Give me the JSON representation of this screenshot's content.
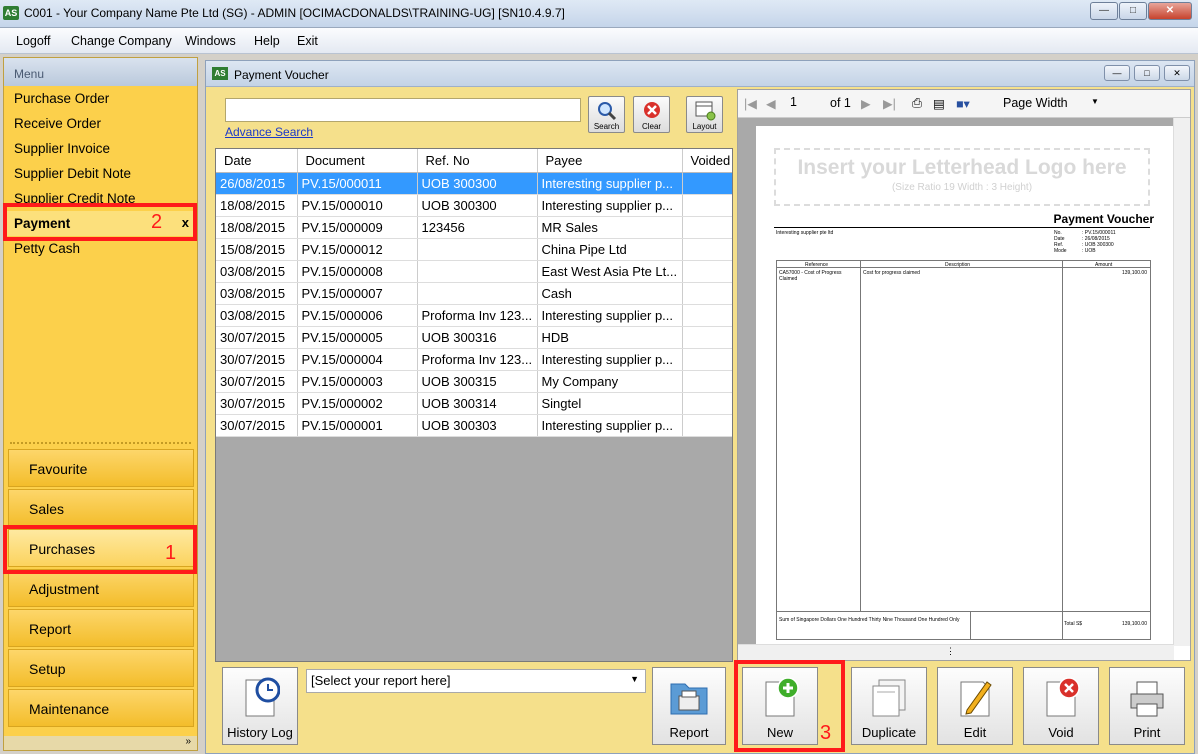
{
  "window": {
    "title": "C001 - Your Company Name Pte Ltd (SG) - ADMIN [OCIMACDONALDS\\TRAINING-UG] [SN10.4.9.7]",
    "app_icon": "AS"
  },
  "menubar": [
    "Logoff",
    "Change Company",
    "Windows",
    "Help",
    "Exit"
  ],
  "sidebar": {
    "header": "Menu",
    "items": [
      "Purchase Order",
      "Receive Order",
      "Supplier Invoice",
      "Supplier Debit Note",
      "Supplier Credit Note",
      "Payment",
      "Petty Cash"
    ],
    "active_item": "Payment",
    "close_label": "x",
    "groups": [
      "Favourite",
      "Sales",
      "Purchases",
      "Adjustment",
      "Report",
      "Setup",
      "Maintenance"
    ]
  },
  "annotations": [
    "1",
    "2",
    "3"
  ],
  "main": {
    "title": "Payment Voucher",
    "icon": "AS",
    "search_placeholder": "",
    "advance_search": "Advance Search",
    "tool_buttons": [
      "Search",
      "Clear",
      "Layout"
    ],
    "columns": [
      "Date",
      "Document",
      "Ref. No",
      "Payee",
      "Voided"
    ],
    "rows": [
      [
        "26/08/2015",
        "PV.15/000011",
        "UOB 300300",
        "Interesting supplier p...",
        ""
      ],
      [
        "18/08/2015",
        "PV.15/000010",
        "UOB 300300",
        "Interesting supplier p...",
        ""
      ],
      [
        "18/08/2015",
        "PV.15/000009",
        "123456",
        "MR Sales",
        ""
      ],
      [
        "15/08/2015",
        "PV.15/000012",
        "",
        "China Pipe Ltd",
        ""
      ],
      [
        "03/08/2015",
        "PV.15/000008",
        "",
        "East West Asia Pte Lt...",
        ""
      ],
      [
        "03/08/2015",
        "PV.15/000007",
        "",
        "Cash",
        ""
      ],
      [
        "03/08/2015",
        "PV.15/000006",
        "Proforma Inv 123...",
        "Interesting supplier p...",
        ""
      ],
      [
        "30/07/2015",
        "PV.15/000005",
        "UOB 300316",
        "HDB",
        ""
      ],
      [
        "30/07/2015",
        "PV.15/000004",
        "Proforma Inv 123...",
        "Interesting supplier p...",
        ""
      ],
      [
        "30/07/2015",
        "PV.15/000003",
        "UOB 300315",
        "My Company",
        ""
      ],
      [
        "30/07/2015",
        "PV.15/000002",
        "UOB 300314",
        "Singtel",
        ""
      ],
      [
        "30/07/2015",
        "PV.15/000001",
        "UOB 300303",
        "Interesting supplier p...",
        ""
      ]
    ],
    "selected_row": 0
  },
  "preview": {
    "page": "1",
    "of_label": "of 1",
    "zoom": "Page Width",
    "logo_line1": "Insert your Letterhead Logo here",
    "logo_line2": "(Size Ratio 19 Width : 3 Height)",
    "heading": "Payment Voucher",
    "supplier": "Interesting supplier pte ltd",
    "meta_labels": "No.\nDate\nRef.\nMode",
    "meta_values": ": PV.15/000011\n: 26/08/2015\n: UOB 300300\n: UOB",
    "col_reference": "Reference",
    "col_description": "Description",
    "col_amount": "Amount",
    "line_reference": "CA57000 - Cost of Progress Claimed",
    "line_description": "Cost for progress claimed",
    "line_amount": "139,100.00",
    "amount_words": "Sum of Singapore Dollars One Hundred Thirty Nine Thousand One Hundred Only",
    "total_label": "Total S$",
    "total_value": "139,100.00"
  },
  "bottom": {
    "history_log": "History Log",
    "report_select": "[Select your report here]",
    "report": "Report",
    "new": "New",
    "duplicate": "Duplicate",
    "edit": "Edit",
    "void": "Void",
    "print": "Print"
  }
}
